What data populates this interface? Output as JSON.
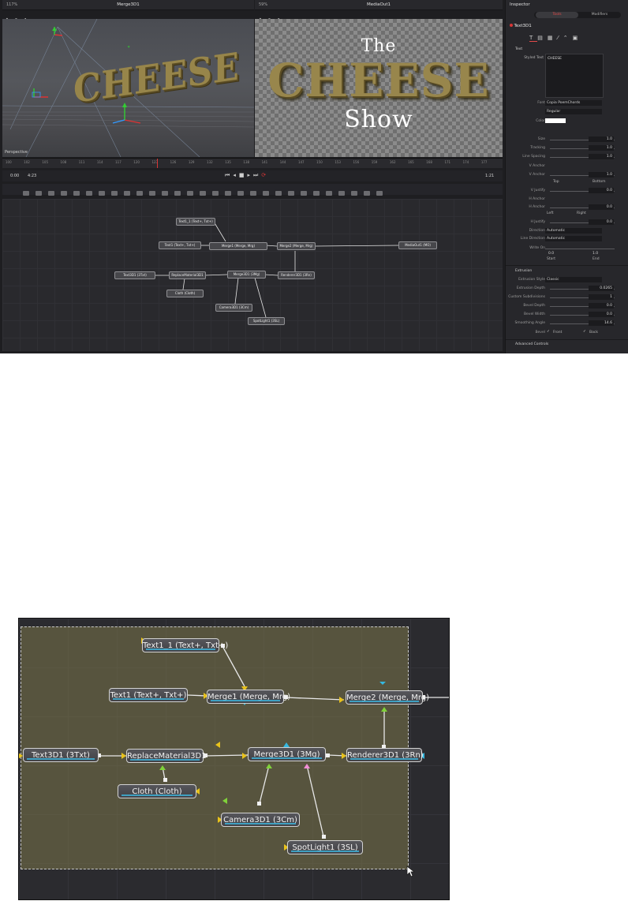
{
  "viewer_left": {
    "title": "Merge3D1",
    "zoom": "117%",
    "label": "Perspective"
  },
  "viewer_right": {
    "title": "MediaOut1",
    "zoom": "59%",
    "text_line1": "The",
    "text_line2": "CHEESE",
    "text_line3": "Show"
  },
  "scene_text": "CHEESE",
  "ruler_ticks": [
    "100",
    "102",
    "105",
    "108",
    "111",
    "114",
    "117",
    "120",
    "123",
    "126",
    "129",
    "132",
    "135",
    "138",
    "141",
    "144",
    "147",
    "150",
    "153",
    "156",
    "159",
    "162",
    "165",
    "168",
    "171",
    "174",
    "177"
  ],
  "transport": {
    "time_start": "0:00",
    "time_end": "4:23",
    "timecode": "1:21"
  },
  "inspector": {
    "title": "Inspector",
    "tab_tools": "Tools",
    "tab_modifiers": "Modifiers",
    "node": "Text3D1",
    "section_text": "Text",
    "styled_text_label": "Styled Text",
    "styled_text_value": "CHEESE",
    "font_label": "Font",
    "font_value": "Copia PoemChords",
    "font_style": "Regular",
    "color_label": "Color",
    "rows": [
      {
        "label": "Size",
        "value": "1.0"
      },
      {
        "label": "Tracking",
        "value": "1.0"
      },
      {
        "label": "Line Spacing",
        "value": "1.0"
      },
      {
        "label": "V Anchor",
        "value": ""
      },
      {
        "label": "V Anchor",
        "value": "1.0"
      }
    ],
    "top_bottom": [
      "Top",
      "Bottom"
    ],
    "v_justify": {
      "label": "V Justify",
      "value": "0.0"
    },
    "h_anchor": "H Anchor",
    "h_anchor2": {
      "label": "H Anchor",
      "value": "0.0"
    },
    "left_right": [
      "Left",
      "Right"
    ],
    "h_justify": {
      "label": "H Justify",
      "value": "0.0"
    },
    "direction": {
      "label": "Direction",
      "value": "Automatic"
    },
    "line_direction": {
      "label": "Line Direction",
      "value": "Automatic"
    },
    "write_on": {
      "label": "Write On",
      "start": "0.0",
      "end": "1.0",
      "start_label": "Start",
      "end_label": "End"
    },
    "section_extrusion": "Extrusion",
    "extrusion_style": {
      "label": "Extrusion Style",
      "value": "Classic"
    },
    "ext_rows": [
      {
        "label": "Extrusion Depth",
        "value": "0.0265"
      },
      {
        "label": "Custom Subdivisions",
        "value": "1"
      },
      {
        "label": "Bevel Depth",
        "value": "0.0"
      },
      {
        "label": "Bevel Width",
        "value": "0.0"
      },
      {
        "label": "Smoothing Angle",
        "value": "14.6"
      }
    ],
    "bevel_label": "Bevel",
    "front": "Front",
    "back": "Back",
    "advanced": "Advanced Controls"
  },
  "nodes_small": [
    "Text1_1 (Text+, Txt+)",
    "Text1 (Text+, Txt+)",
    "Merge1 (Merge, Mrg)",
    "Merge2 (Merge, Mrg)",
    "MediaOut1 (MO)",
    "Text3D1 (3Txt)",
    "ReplaceMaterial3D1",
    "Merge3D1 (3Mg)",
    "Renderer3D1 (3Rn)",
    "Cloth (Cloth)",
    "Camera3D1 (3Cm)",
    "SpotLight1 (3SL)"
  ],
  "nodes_big": [
    "Text1_1 (Text+, Txt+)",
    "Text1 (Text+, Txt+)",
    "Merge1 (Merge, Mrg)",
    "Merge2 (Merge, Mrg)",
    "Text3D1 (3Txt)",
    "ReplaceMaterial3D1",
    "Merge3D1 (3Mg)",
    "Renderer3D1 (3Rn)",
    "Cloth (Cloth)",
    "Camera3D1 (3Cm)",
    "SpotLight1 (3SL)"
  ],
  "colors": {
    "accent_red": "#d93636",
    "wire": "#e6e6e6",
    "selection": "#807a4c",
    "cyan": "#35b8e0",
    "yellow": "#e8c21c"
  }
}
